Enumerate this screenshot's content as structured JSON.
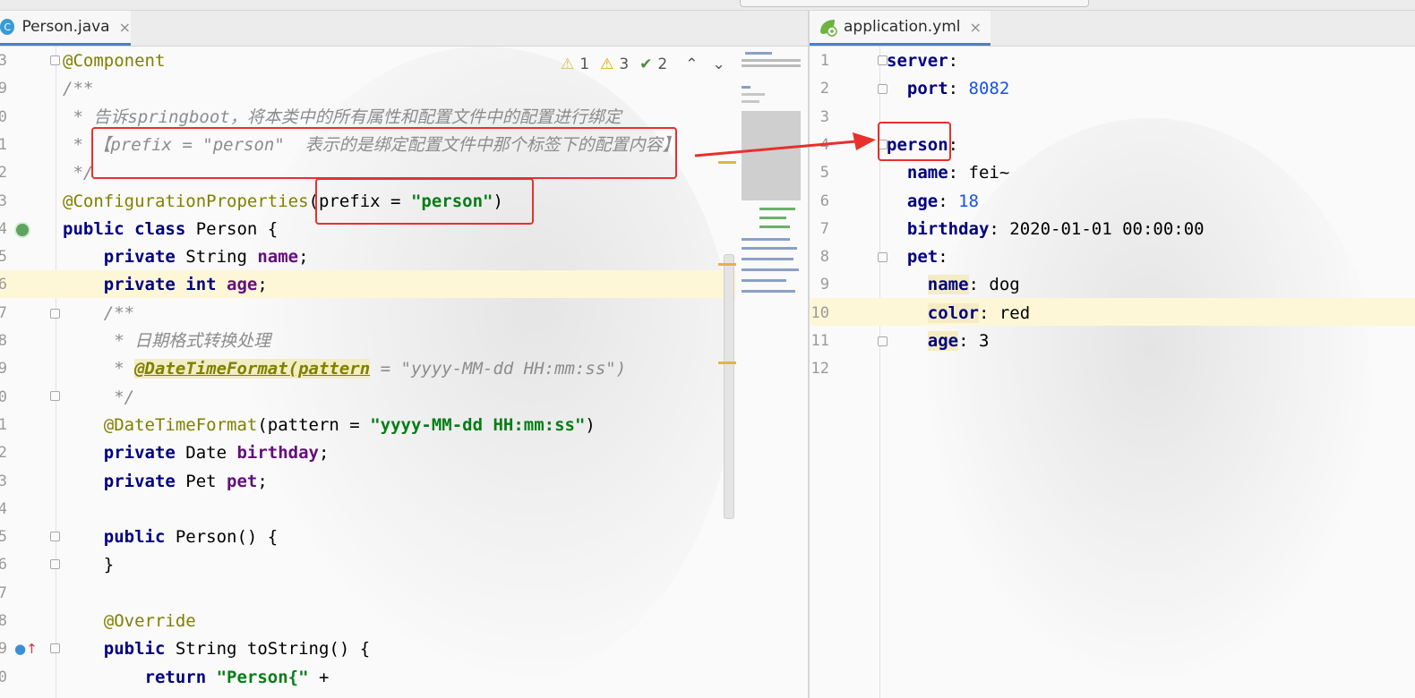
{
  "left_tab": {
    "label": "Person.java",
    "icon": "java-class-icon",
    "close": "×"
  },
  "right_tab": {
    "label": "application.yml",
    "icon": "spring-icon",
    "close": "×"
  },
  "inspections": {
    "weak_warnings": "1",
    "warnings": "3",
    "typos": "2",
    "up": "⌃",
    "down": "⌄"
  },
  "java_lines": [
    {
      "num": "3",
      "segments": [
        {
          "t": "@Component",
          "c": "ann"
        }
      ]
    },
    {
      "num": "9",
      "segments": [
        {
          "t": "/**",
          "c": "cm"
        }
      ]
    },
    {
      "num": "0",
      "segments": [
        {
          "t": " * 告诉springboot，将本类中的所有属性和配置文件中的配置进行绑定",
          "c": "cm"
        }
      ]
    },
    {
      "num": "1",
      "segments": [
        {
          "t": " * ",
          "c": "cm"
        },
        {
          "t": "【prefix = \"person\"  表示的是绑定配置文件中那个标签下的配置内容】",
          "c": "cm"
        }
      ]
    },
    {
      "num": "2",
      "segments": [
        {
          "t": " */",
          "c": "cm"
        }
      ]
    },
    {
      "num": "3",
      "segments": [
        {
          "t": "@ConfigurationProperties",
          "c": "ann"
        },
        {
          "t": "(prefix = ",
          "c": ""
        },
        {
          "t": "\"person\"",
          "c": "str"
        },
        {
          "t": ")",
          "c": ""
        }
      ]
    },
    {
      "num": "4",
      "segments": [
        {
          "t": "public class ",
          "c": "kw"
        },
        {
          "t": "Person {",
          "c": ""
        }
      ]
    },
    {
      "num": "5",
      "segments": [
        {
          "t": "    private ",
          "c": "kw"
        },
        {
          "t": "String ",
          "c": ""
        },
        {
          "t": "name",
          "c": "fld"
        },
        {
          "t": ";",
          "c": ""
        }
      ]
    },
    {
      "num": "6",
      "segments": [
        {
          "t": "    private int ",
          "c": "kw"
        },
        {
          "t": "age",
          "c": "fld"
        },
        {
          "t": ";",
          "c": ""
        }
      ]
    },
    {
      "num": "7",
      "segments": [
        {
          "t": "    /**",
          "c": "cm"
        }
      ]
    },
    {
      "num": "8",
      "segments": [
        {
          "t": "     * 日期格式转换处理",
          "c": "cm"
        }
      ]
    },
    {
      "num": "9",
      "segments": [
        {
          "t": "     * ",
          "c": "cm"
        },
        {
          "t": "@DateTimeFormat(pattern",
          "c": "cmtag"
        },
        {
          "t": " = \"yyyy-MM-dd HH:mm:ss\")",
          "c": "cm"
        }
      ]
    },
    {
      "num": "0",
      "segments": [
        {
          "t": "     */",
          "c": "cm"
        }
      ]
    },
    {
      "num": "1",
      "segments": [
        {
          "t": "    @DateTimeFormat",
          "c": "ann"
        },
        {
          "t": "(pattern = ",
          "c": ""
        },
        {
          "t": "\"yyyy-MM-dd HH:mm:ss\"",
          "c": "str"
        },
        {
          "t": ")",
          "c": ""
        }
      ]
    },
    {
      "num": "2",
      "segments": [
        {
          "t": "    private ",
          "c": "kw"
        },
        {
          "t": "Date ",
          "c": ""
        },
        {
          "t": "birthday",
          "c": "fld"
        },
        {
          "t": ";",
          "c": ""
        }
      ]
    },
    {
      "num": "3",
      "segments": [
        {
          "t": "    private ",
          "c": "kw"
        },
        {
          "t": "Pet ",
          "c": ""
        },
        {
          "t": "pet",
          "c": "fld"
        },
        {
          "t": ";",
          "c": ""
        }
      ]
    },
    {
      "num": "4",
      "segments": []
    },
    {
      "num": "5",
      "segments": [
        {
          "t": "    public ",
          "c": "kw"
        },
        {
          "t": "Person() {",
          "c": ""
        }
      ]
    },
    {
      "num": "6",
      "segments": [
        {
          "t": "    }",
          "c": ""
        }
      ]
    },
    {
      "num": "7",
      "segments": []
    },
    {
      "num": "8",
      "segments": [
        {
          "t": "    @Override",
          "c": "ann"
        }
      ]
    },
    {
      "num": "9",
      "segments": [
        {
          "t": "    public ",
          "c": "kw"
        },
        {
          "t": "String toString() {",
          "c": ""
        }
      ]
    },
    {
      "num": "0",
      "segments": [
        {
          "t": "        return ",
          "c": "kw"
        },
        {
          "t": "\"Person{\"",
          "c": "str"
        },
        {
          "t": " +",
          "c": ""
        }
      ]
    }
  ],
  "yml_lines": [
    {
      "num": "1",
      "segments": [
        {
          "t": "server",
          "c": "ykey"
        },
        {
          "t": ":",
          "c": ""
        }
      ]
    },
    {
      "num": "2",
      "segments": [
        {
          "t": "  port",
          "c": "ykey"
        },
        {
          "t": ": ",
          "c": ""
        },
        {
          "t": "8082",
          "c": "num"
        }
      ]
    },
    {
      "num": "3",
      "segments": []
    },
    {
      "num": "4",
      "segments": [
        {
          "t": "person",
          "c": "ykey"
        },
        {
          "t": ":",
          "c": ""
        }
      ]
    },
    {
      "num": "5",
      "segments": [
        {
          "t": "  name",
          "c": "ykey"
        },
        {
          "t": ": fei~",
          "c": ""
        }
      ]
    },
    {
      "num": "6",
      "segments": [
        {
          "t": "  age",
          "c": "ykey"
        },
        {
          "t": ": ",
          "c": ""
        },
        {
          "t": "18",
          "c": "num"
        }
      ]
    },
    {
      "num": "7",
      "segments": [
        {
          "t": "  birthday",
          "c": "ykey"
        },
        {
          "t": ": 2020-01-01 00:00:00",
          "c": ""
        }
      ]
    },
    {
      "num": "8",
      "segments": [
        {
          "t": "  pet",
          "c": "ykey"
        },
        {
          "t": ":",
          "c": ""
        }
      ]
    },
    {
      "num": "9",
      "segments": [
        {
          "t": "    ",
          "c": ""
        },
        {
          "t": "name",
          "c": "ykey yhl"
        },
        {
          "t": ": dog",
          "c": ""
        }
      ]
    },
    {
      "num": "10",
      "segments": [
        {
          "t": "    ",
          "c": ""
        },
        {
          "t": "color",
          "c": "ykey yhl"
        },
        {
          "t": ": red",
          "c": ""
        }
      ]
    },
    {
      "num": "11",
      "segments": [
        {
          "t": "    ",
          "c": ""
        },
        {
          "t": "age",
          "c": "ykey yhl"
        },
        {
          "t": ": 3",
          "c": ""
        }
      ]
    },
    {
      "num": "12",
      "segments": []
    }
  ],
  "colors": {
    "keyword": "#000080",
    "annotation": "#808000",
    "string": "#067d17",
    "field": "#660e7a",
    "number": "#1750eb",
    "comment": "#8c8c8c",
    "highlight_box": "#e8302c",
    "active_tab": "#4083c9"
  }
}
